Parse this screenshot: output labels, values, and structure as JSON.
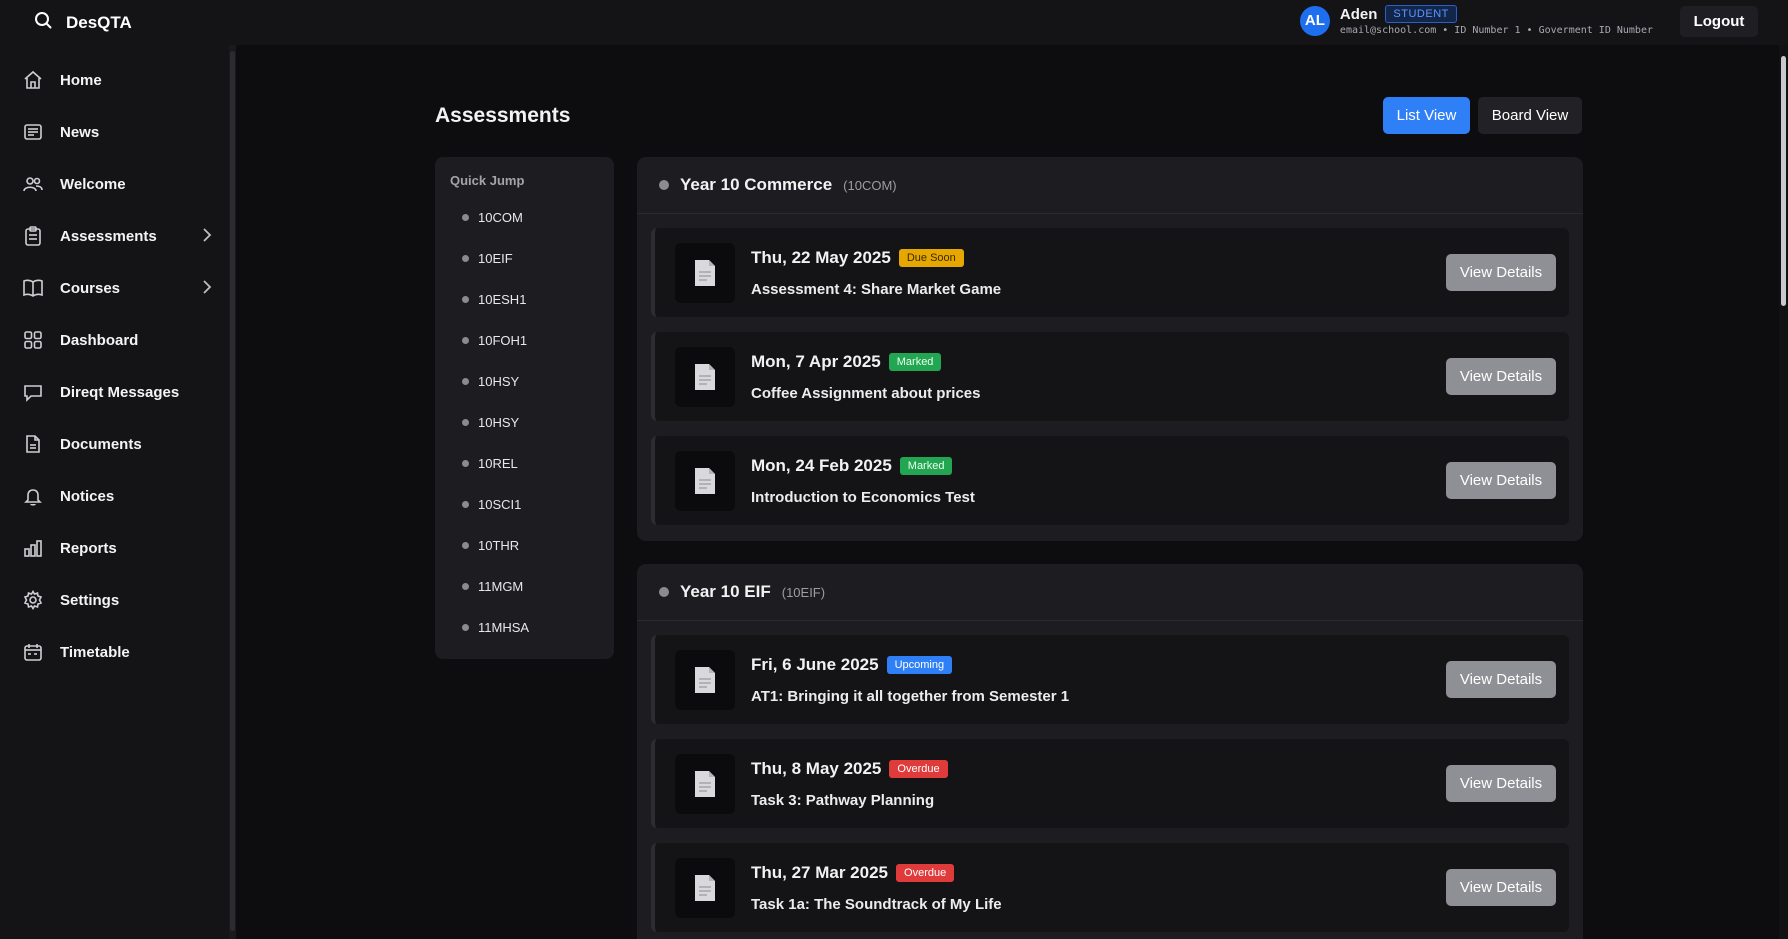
{
  "app": {
    "title": "DesQTA"
  },
  "user": {
    "initials": "AL",
    "name": "Aden",
    "role": "STUDENT",
    "details": "email@school.com • ID Number 1 • Goverment ID Number",
    "logout_label": "Logout"
  },
  "sidebar": {
    "items": [
      {
        "label": "Home",
        "icon": "home-icon"
      },
      {
        "label": "News",
        "icon": "news-icon"
      },
      {
        "label": "Welcome",
        "icon": "people-icon"
      },
      {
        "label": "Assessments",
        "icon": "clipboard-icon",
        "expandable": true
      },
      {
        "label": "Courses",
        "icon": "book-icon",
        "expandable": true
      },
      {
        "label": "Dashboard",
        "icon": "grid-icon"
      },
      {
        "label": "Direqt Messages",
        "icon": "chat-icon"
      },
      {
        "label": "Documents",
        "icon": "document-icon"
      },
      {
        "label": "Notices",
        "icon": "bell-icon"
      },
      {
        "label": "Reports",
        "icon": "bar-chart-icon"
      },
      {
        "label": "Settings",
        "icon": "gear-icon"
      },
      {
        "label": "Timetable",
        "icon": "calendar-icon"
      }
    ]
  },
  "main": {
    "title": "Assessments",
    "view_buttons": {
      "list": "List View",
      "board": "Board View",
      "active": "list"
    },
    "quick_jump": {
      "title": "Quick Jump",
      "items": [
        "10COM",
        "10EIF",
        "10ESH1",
        "10FOH1",
        "10HSY",
        "10HSY",
        "10REL",
        "10SCI1",
        "10THR",
        "11MGM",
        "11MHSA"
      ]
    },
    "sections": [
      {
        "name": "Year 10 Commerce",
        "code": "(10COM)",
        "assessments": [
          {
            "date": "Thu, 22 May 2025",
            "status": "Due Soon",
            "title": "Assessment 4: Share Market Game",
            "action": "View Details"
          },
          {
            "date": "Mon, 7 Apr 2025",
            "status": "Marked",
            "title": "Coffee Assignment about prices",
            "action": "View Details"
          },
          {
            "date": "Mon, 24 Feb 2025",
            "status": "Marked",
            "title": "Introduction to Economics Test",
            "action": "View Details"
          }
        ]
      },
      {
        "name": "Year 10 EIF",
        "code": "(10EIF)",
        "assessments": [
          {
            "date": "Fri, 6 June 2025",
            "status": "Upcoming",
            "title": "AT1: Bringing it all together from Semester 1",
            "action": "View Details"
          },
          {
            "date": "Thu, 8 May 2025",
            "status": "Overdue",
            "title": "Task 3: Pathway Planning",
            "action": "View Details"
          },
          {
            "date": "Thu, 27 Mar 2025",
            "status": "Overdue",
            "title": "Task 1a: The Soundtrack of My Life",
            "action": "View Details"
          }
        ]
      }
    ]
  },
  "colors": {
    "accent": "#2f7ff7",
    "due_soon": "#e6a700",
    "marked": "#22a652",
    "upcoming": "#2f7ff7",
    "overdue": "#e03b3b"
  }
}
